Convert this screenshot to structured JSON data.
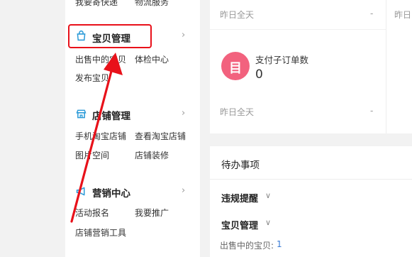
{
  "sidebar": {
    "top_links": [
      "我要寄快递",
      "物流服务"
    ],
    "sections": [
      {
        "title": "宝贝管理",
        "links": [
          "出售中的宝贝",
          "体检中心",
          "发布宝贝"
        ]
      },
      {
        "title": "店铺管理",
        "links": [
          "手机淘宝店铺",
          "查看淘宝店铺",
          "图片空间",
          "店铺装修"
        ]
      },
      {
        "title": "营销中心",
        "links": [
          "活动报名",
          "我要推广",
          "店铺营销工具"
        ]
      }
    ]
  },
  "stats": {
    "top_row": {
      "period": "昨日全天",
      "dash": "-",
      "period_right": "昨日"
    },
    "order_card": {
      "icon_glyph": "目",
      "label": "支付子订单数",
      "value": "0",
      "period": "昨日全天",
      "dash": "-"
    }
  },
  "todo": {
    "title": "待办事项",
    "items": [
      {
        "label": "违规提醒"
      },
      {
        "label": "宝贝管理"
      }
    ],
    "onsale_label": "出售中的宝贝:",
    "onsale_count": "1"
  },
  "colors": {
    "highlight": "#e8111a",
    "order_icon_bg": "#f2627e",
    "link_blue": "#3a7bd5",
    "icon_blue": "#2d9bd8"
  }
}
